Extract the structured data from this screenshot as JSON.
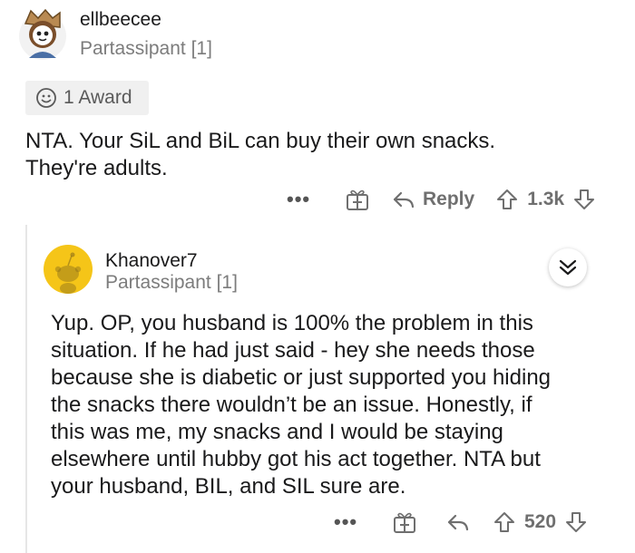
{
  "comment1": {
    "username": "ellbeecee",
    "flair": "Partassipant [1]",
    "award_label": "1 Award",
    "body": [
      "NTA.  Your SiL and BiL can buy their own snacks.",
      "They're adults."
    ],
    "actions": {
      "more": "•••",
      "reply_label": "Reply",
      "score": "1.3k"
    }
  },
  "comment2": {
    "username": "Khanover7",
    "flair": "Partassipant [1]",
    "body": [
      "Yup. OP, you husband is 100% the problem in this",
      "situation. If he had just said - hey she needs those",
      "because she is diabetic or just supported you hiding",
      "the snacks there wouldn’t be an issue. Honestly, if",
      "this was me, my snacks and I would be staying",
      "elsewhere until hubby got his act together. NTA but",
      "your husband, BIL, and SIL sure are."
    ],
    "actions": {
      "more": "•••",
      "score": "520"
    }
  },
  "colors": {
    "text": "#1a1a1b",
    "muted": "#7c7c7c",
    "award_bg": "#f0f0f0",
    "avatar_yellow": "#f5c518"
  },
  "icons": [
    "avatar-1",
    "award-icon",
    "gift-icon",
    "reply-icon",
    "upvote-icon",
    "downvote-icon",
    "snoo-avatar",
    "collapse-chevron-icon"
  ]
}
